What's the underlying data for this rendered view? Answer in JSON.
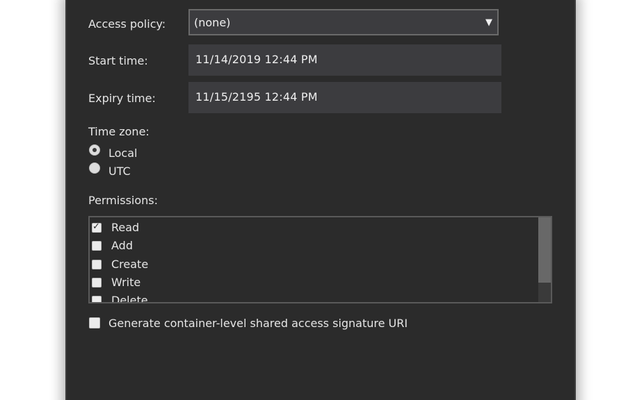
{
  "form": {
    "access_policy_label": "Access policy:",
    "access_policy_value": "(none)",
    "start_time_label": "Start time:",
    "start_time_value": "11/14/2019 12:44 PM",
    "expiry_time_label": "Expiry time:",
    "expiry_time_value": "11/15/2195 12:44 PM",
    "time_zone_label": "Time zone:",
    "time_zone_options": [
      {
        "label": "Local",
        "selected": true
      },
      {
        "label": "UTC",
        "selected": false
      }
    ],
    "permissions_label": "Permissions:",
    "permissions": [
      {
        "label": "Read",
        "checked": true
      },
      {
        "label": "Add",
        "checked": false
      },
      {
        "label": "Create",
        "checked": false
      },
      {
        "label": "Write",
        "checked": false
      },
      {
        "label": "Delete",
        "checked": false
      }
    ],
    "container_uri_label": "Generate container-level shared access signature URI",
    "container_uri_checked": false
  },
  "icons": {
    "dropdown": "chevron-down-icon",
    "check": "checkmark-icon"
  },
  "colors": {
    "dialog_bg": "#2b2b2b",
    "field_bg": "#3c3c3f",
    "text": "#e6e6e6"
  }
}
